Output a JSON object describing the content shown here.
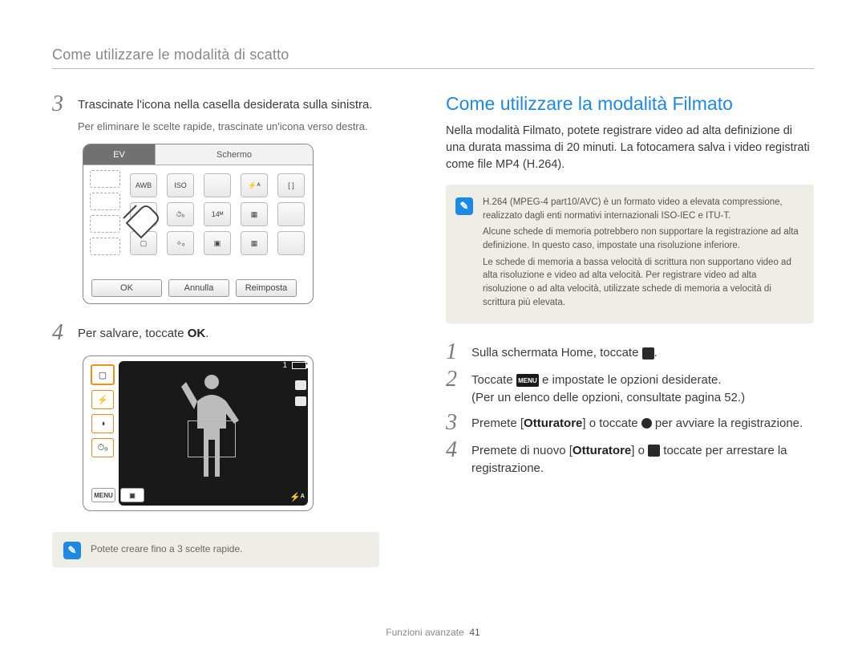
{
  "header": {
    "title": "Come utilizzare le modalità di scatto"
  },
  "left": {
    "step3": {
      "num": "3",
      "text": "Trascinate l'icona nella casella desiderata sulla sinistra.",
      "sub": "Per eliminare le scelte rapide, trascinate un'icona verso destra."
    },
    "shot1": {
      "tab_ev": "EV",
      "tab_schermo": "Schermo",
      "btn_ok": "OK",
      "btn_annulla": "Annulla",
      "btn_reimposta": "Reimposta"
    },
    "step4": {
      "num": "4",
      "text_pre": "Per salvare, toccate ",
      "ok": "OK",
      "text_post": "."
    },
    "shot2": {
      "menu": "MENU",
      "counter": "1",
      "flash": "⚡ᴬ"
    },
    "note": "Potete creare fino a 3 scelte rapide."
  },
  "right": {
    "title": "Come utilizzare la modalità Filmato",
    "intro": "Nella modalità Filmato, potete registrare video ad alta definizione di una durata massima di 20 minuti. La fotocamera salva i video registrati come file MP4 (H.264).",
    "info": {
      "item1": "H.264 (MPEG-4 part10/AVC) è un formato video a elevata compressione, realizzato dagli enti normativi internazionali ISO-IEC e ITU-T.",
      "item2": "Alcune schede di memoria potrebbero non supportare la registrazione ad alta definizione. In questo caso, impostate una risoluzione inferiore.",
      "item3": "Le schede di memoria a bassa velocità di scrittura non supportano video ad alta risoluzione e video ad alta velocità. Per registrare video ad alta risoluzione o ad alta velocità, utilizzate schede di memoria a velocità di scrittura più elevata."
    },
    "step1": {
      "num": "1",
      "pre": "Sulla schermata Home, toccate ",
      "post": "."
    },
    "step2": {
      "num": "2",
      "pre": "Toccate ",
      "menu": "MENU",
      "mid": " e impostate le opzioni desiderate.",
      "sub": "(Per un elenco delle opzioni, consultate pagina 52.)"
    },
    "step3": {
      "num": "3",
      "pre": "Premete [",
      "b1": "Otturatore",
      "mid": "] o toccate ",
      "post": " per avviare la registrazione."
    },
    "step4": {
      "num": "4",
      "pre": "Premete di nuovo [",
      "b1": "Otturatore",
      "mid": "] o ",
      "post": " toccate per arrestare la registrazione."
    }
  },
  "footer": {
    "label": "Funzioni avanzate",
    "page": "41"
  }
}
